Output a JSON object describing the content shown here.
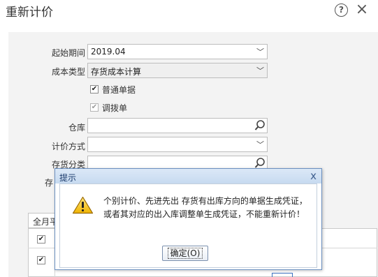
{
  "window": {
    "title": "重新计价"
  },
  "form": {
    "start_period": {
      "label": "起始期间",
      "value": "2019.04"
    },
    "cost_type": {
      "label": "成本类型",
      "value": "存货成本计算"
    },
    "normal_doc": {
      "label": "普通单据",
      "checked": true
    },
    "transfer_doc": {
      "label": "调拨单",
      "checked": true,
      "disabled": true
    },
    "warehouse": {
      "label": "仓库",
      "value": ""
    },
    "pricing_method": {
      "label": "计价方式",
      "value": ""
    },
    "inventory_class": {
      "label": "存货分类",
      "value": ""
    },
    "hidden_label_char": "存"
  },
  "grid": {
    "tab_label": "全月平"
  },
  "dialog": {
    "title": "提示",
    "message": "个别计价、先进先出 存货有出库方向的单据生成凭证，或者其对应的出入库调整单生成凭证，不能重新计价！",
    "ok_label": "确定(O)"
  },
  "icons": {
    "help": "help-icon",
    "close": "close-icon",
    "dropdown": "chevron-down-icon",
    "lookup": "magnifier-icon",
    "warning": "warning-triangle-icon"
  }
}
